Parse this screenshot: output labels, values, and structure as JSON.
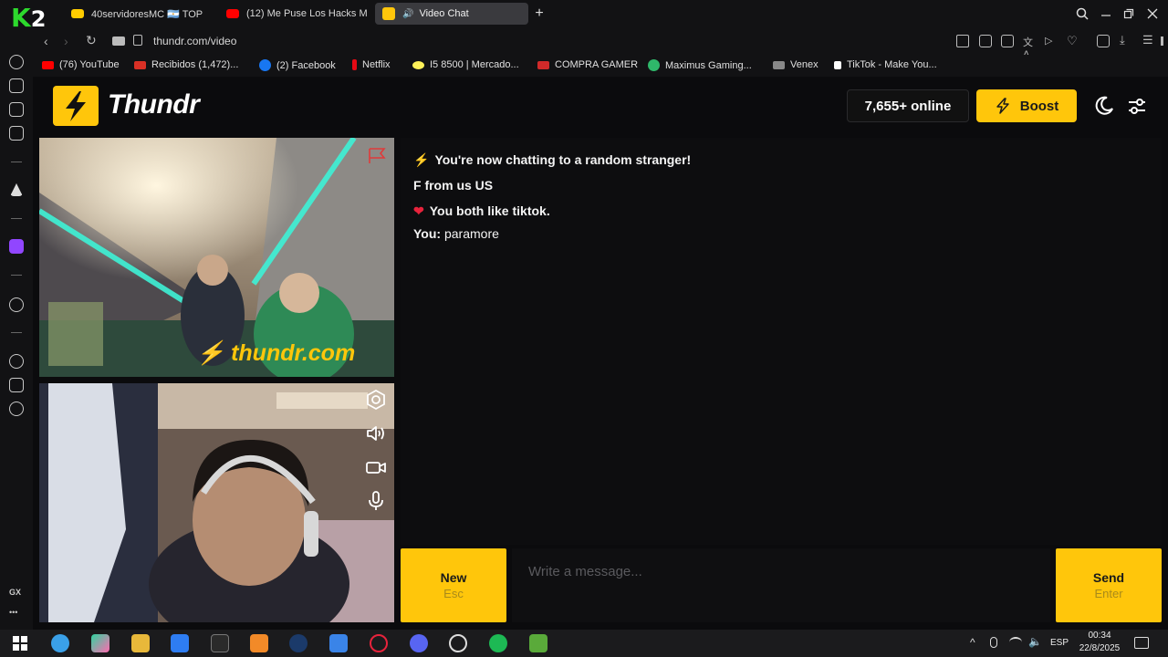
{
  "browser": {
    "tabs": [
      {
        "label": "40servidoresMC 🇦🇷 TOP",
        "color": "#ffcc00"
      },
      {
        "label": "(12) Me Puse Los Hacks M",
        "color": "#ff0000"
      },
      {
        "label": "Video Chat",
        "color": "#ffc60b",
        "active": true
      }
    ],
    "new_tab_label": "+",
    "url": "thundr.com/video",
    "bookmarks": [
      {
        "label": "(76) YouTube",
        "color": "#ff0000"
      },
      {
        "label": "Recibidos (1,472)...",
        "color": "#d93025"
      },
      {
        "label": "(2) Facebook",
        "color": "#1877f2"
      },
      {
        "label": "Netflix",
        "color": "#e50914"
      },
      {
        "label": "I5 8500 | Mercado...",
        "color": "#fff159"
      },
      {
        "label": "COMPRA GAMER",
        "color": "#d12a2a"
      },
      {
        "label": "Maximus Gaming...",
        "color": "#2fb86a"
      },
      {
        "label": "Venex",
        "color": "#888888"
      },
      {
        "label": "TikTok - Make You...",
        "color": "#ffffff"
      }
    ],
    "sidebar_label_gx": "GX",
    "sidebar_more": "•••"
  },
  "overlay": {
    "k": "K",
    "two": "2"
  },
  "header": {
    "logo_text": "Thundr",
    "online_count": "7,655+ online",
    "boost_label": "Boost",
    "accent": "#ffc60b"
  },
  "remote_video": {
    "watermark": "⚡ thundr.com"
  },
  "chat": {
    "messages": [
      {
        "icon": "⚡",
        "text": "You're now chatting to a random stranger!"
      },
      {
        "icon": "",
        "text": "F from us US"
      },
      {
        "icon": "❤",
        "text": "You both like tiktok."
      },
      {
        "prefix": "You:",
        "text": "paramore"
      }
    ],
    "new_button": {
      "label": "New",
      "shortcut": "Esc"
    },
    "send_button": {
      "label": "Send",
      "shortcut": "Enter"
    },
    "input_placeholder": "Write a message..."
  },
  "taskbar": {
    "language": "ESP",
    "time": "00:34",
    "date": "22/8/2025"
  }
}
